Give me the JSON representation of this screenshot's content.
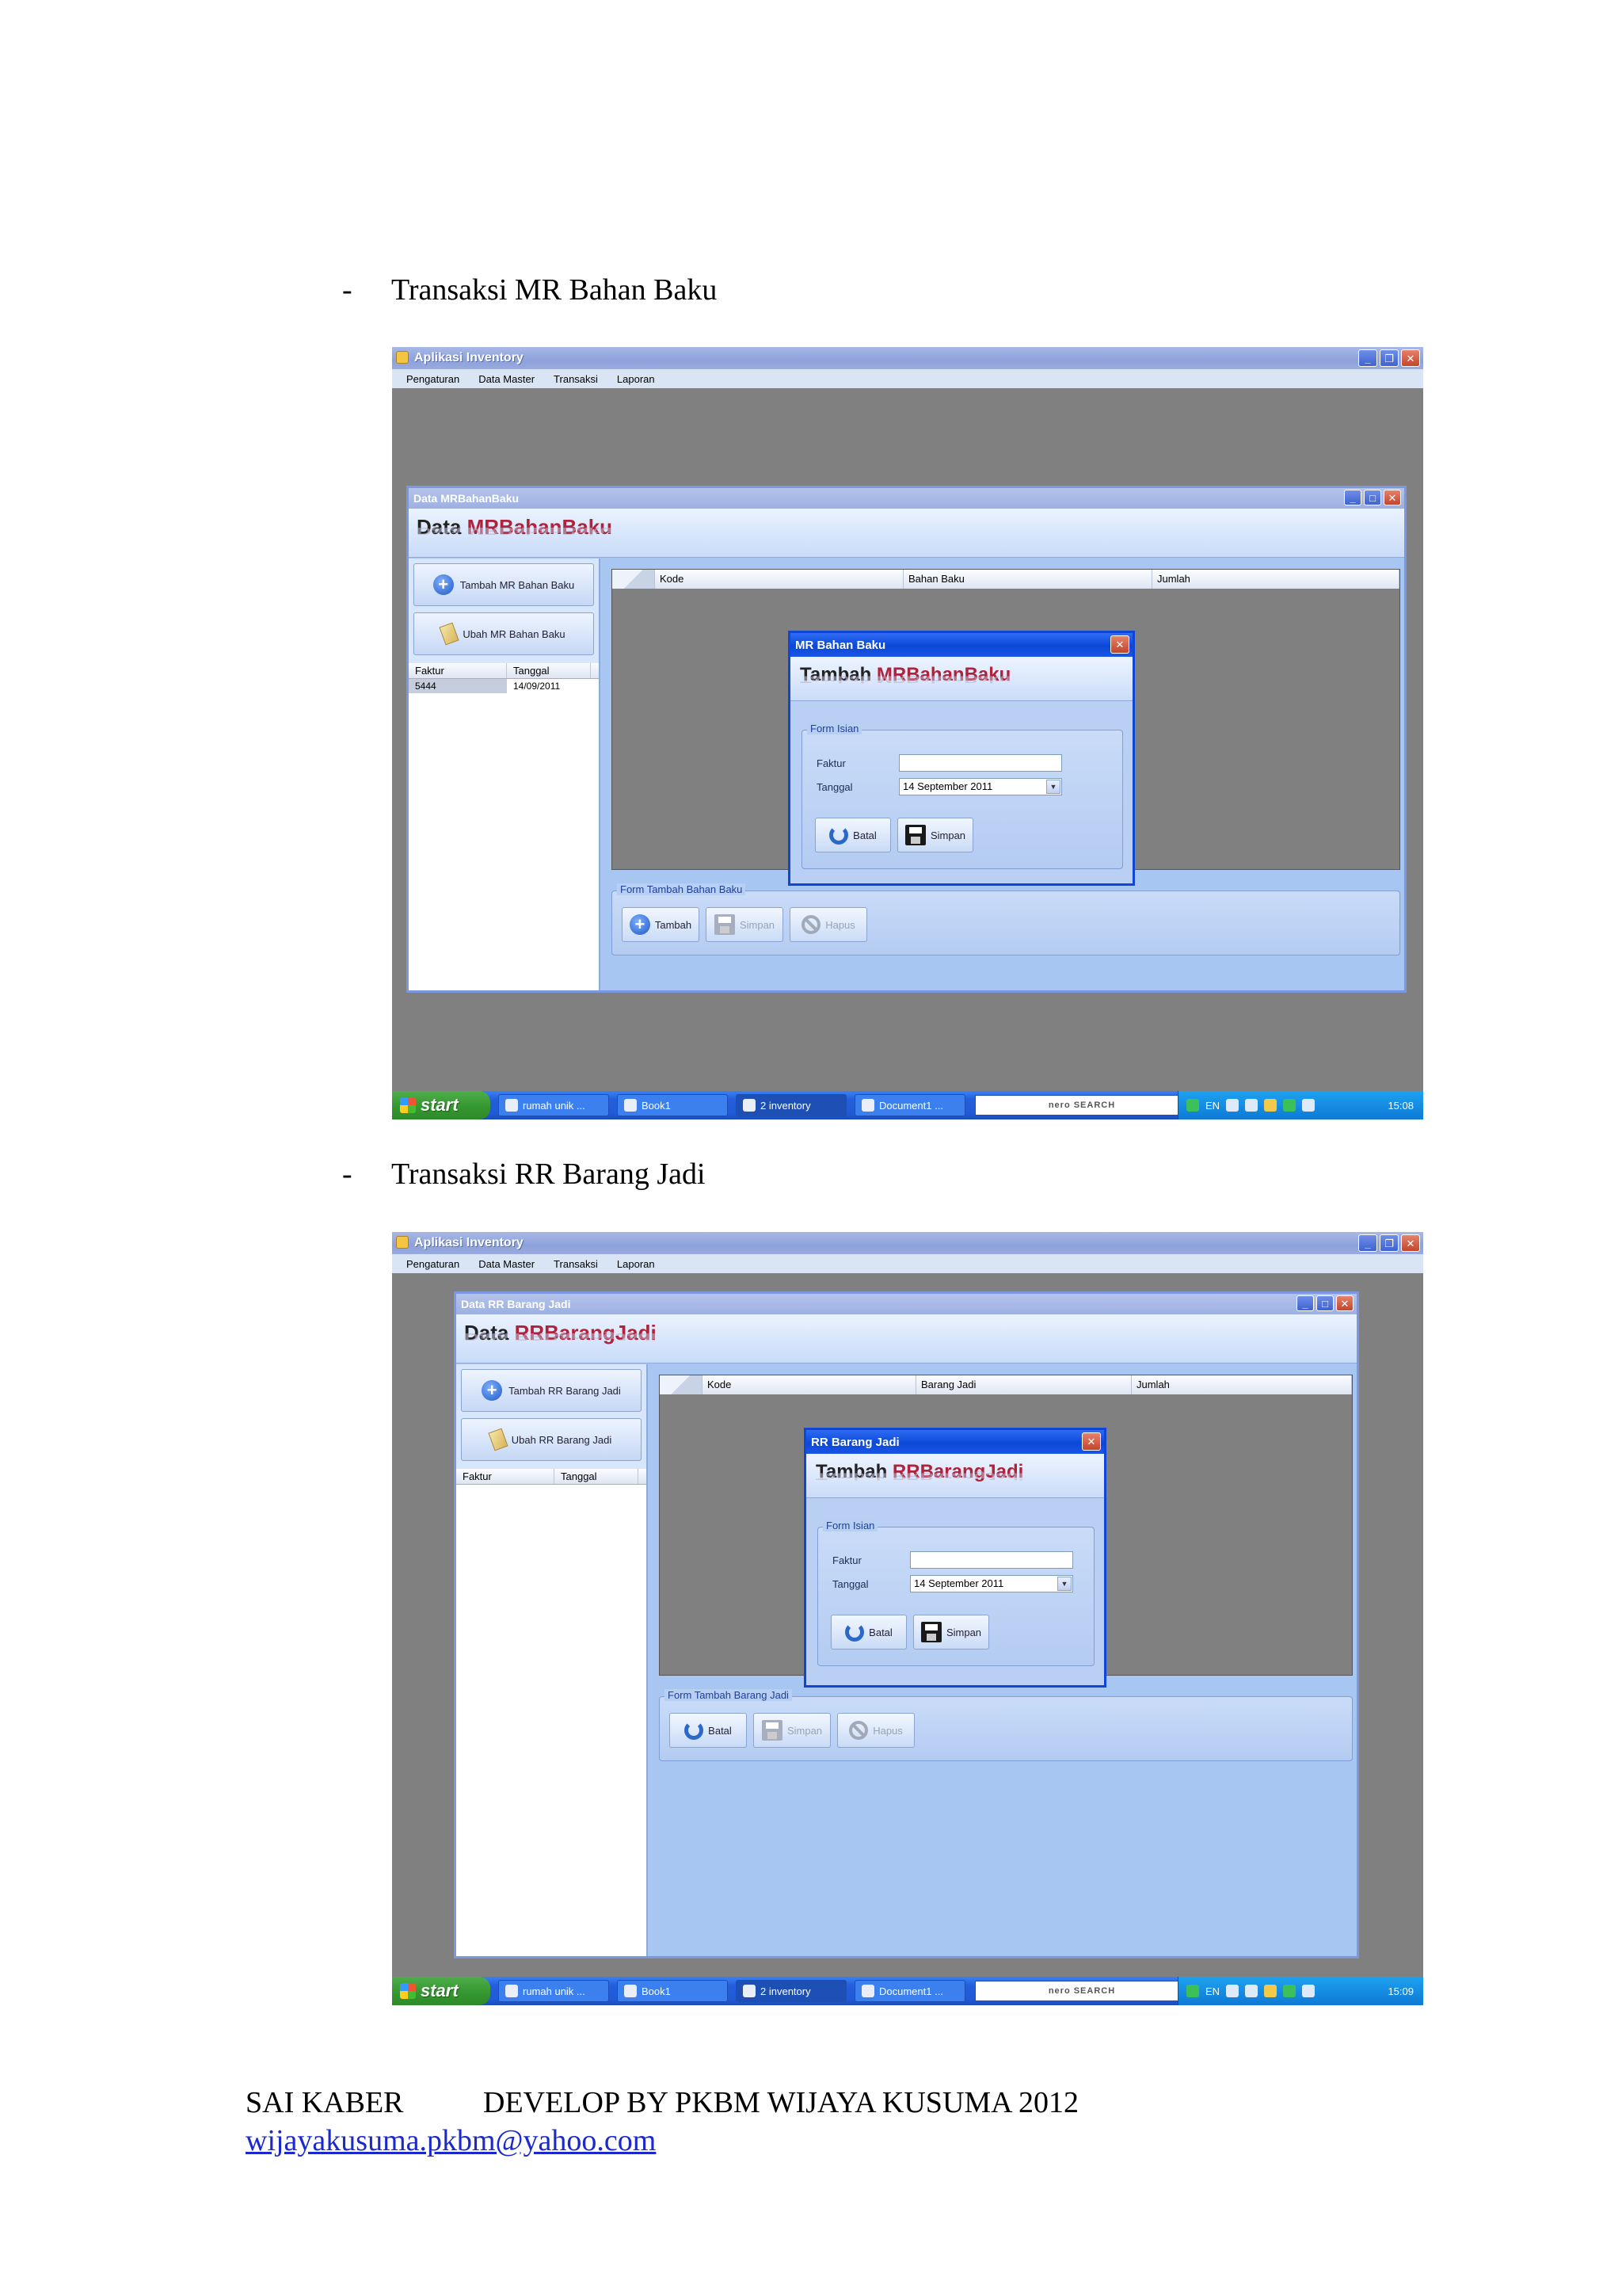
{
  "headings": [
    {
      "dash": "-",
      "text": "Transaksi MR Bahan Baku"
    },
    {
      "dash": "-",
      "text": "Transaksi RR Barang Jadi"
    }
  ],
  "screens": [
    {
      "app_title": "Aplikasi Inventory",
      "menu": [
        "Pengaturan",
        "Data Master",
        "Transaksi",
        "Laporan"
      ],
      "child": {
        "title": "Data MRBahanBaku",
        "header_prefix": "Data",
        "header_highlight": "MRBahanBaku",
        "side_buttons": [
          "Tambah MR Bahan Baku",
          "Ubah MR Bahan Baku"
        ],
        "list_columns": [
          "Faktur",
          "Tanggal"
        ],
        "list_rows": [
          {
            "faktur": "5444",
            "tanggal": "14/09/2011"
          }
        ],
        "grid_columns": [
          "Kode",
          "Bahan Baku",
          "Jumlah"
        ],
        "group_label": "Form Tambah Bahan Baku",
        "group_buttons": [
          "Tambah",
          "Simpan",
          "Hapus"
        ]
      },
      "dialog": {
        "title": "MR Bahan Baku",
        "header_prefix": "Tambah",
        "header_highlight": "MRBahanBaku",
        "group_label": "Form Isian",
        "faktur_label": "Faktur",
        "faktur_value": "",
        "tanggal_label": "Tanggal",
        "tanggal_value": "14 September  2011",
        "buttons": [
          "Batal",
          "Simpan"
        ]
      },
      "taskbar": {
        "start": "start",
        "items": [
          "rumah unik ...",
          "Book1",
          "2 inventory",
          "Document1 ..."
        ],
        "search": "nero SEARCH",
        "lang": "EN",
        "clock": "15:08"
      }
    },
    {
      "app_title": "Aplikasi Inventory",
      "menu": [
        "Pengaturan",
        "Data Master",
        "Transaksi",
        "Laporan"
      ],
      "child": {
        "title": "Data RR Barang Jadi",
        "header_prefix": "Data",
        "header_highlight": "RRBarangJadi",
        "side_buttons": [
          "Tambah RR Barang Jadi",
          "Ubah RR Barang Jadi"
        ],
        "list_columns": [
          "Faktur",
          "Tanggal"
        ],
        "list_rows": [],
        "grid_columns": [
          "Kode",
          "Barang Jadi",
          "Jumlah"
        ],
        "group_label": "Form Tambah Barang Jadi",
        "group_buttons": [
          "Batal",
          "Simpan",
          "Hapus"
        ]
      },
      "dialog": {
        "title": "RR Barang Jadi",
        "header_prefix": "Tambah",
        "header_highlight": "RRBarangJadi",
        "group_label": "Form Isian",
        "faktur_label": "Faktur",
        "faktur_value": "",
        "tanggal_label": "Tanggal",
        "tanggal_value": "14 September  2011",
        "buttons": [
          "Batal",
          "Simpan"
        ]
      },
      "taskbar": {
        "start": "start",
        "items": [
          "rumah unik ...",
          "Book1",
          "2 inventory",
          "Document1 ..."
        ],
        "search": "nero SEARCH",
        "lang": "EN",
        "clock": "15:09"
      }
    }
  ],
  "footer": {
    "left": "SAI KABER",
    "right": "DEVELOP BY PKBM WIJAYA KUSUMA 2012",
    "email": "wijayakusuma.pkbm@yahoo.com"
  }
}
